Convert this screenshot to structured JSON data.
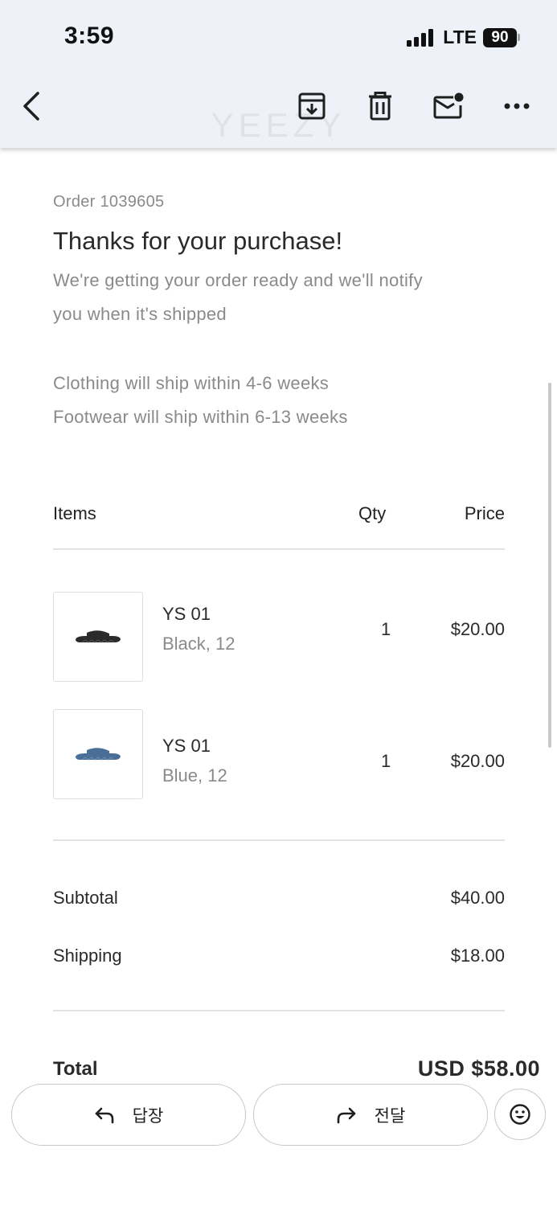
{
  "status_bar": {
    "time": "3:59",
    "network": "LTE",
    "battery": "90"
  },
  "toolbar": {
    "back_icon": "back-icon",
    "archive_icon": "archive-icon",
    "delete_icon": "trash-icon",
    "mark_unread_icon": "mail-unread-icon",
    "more_icon": "more-icon",
    "brand_watermark": "YEEZY"
  },
  "email": {
    "order_number": "Order 1039605",
    "headline": "Thanks for your purchase!",
    "intro_line1": "We're getting your order ready and we'll notify",
    "intro_line2": "you when it's shipped",
    "shipping_note1": "Clothing will ship within 4-6 weeks",
    "shipping_note2": "Footwear will ship within 6-13 weeks",
    "table_headers": {
      "items": "Items",
      "qty": "Qty",
      "price": "Price"
    },
    "items": [
      {
        "name": "YS 01",
        "variant": "Black, 12",
        "qty": "1",
        "price": "$20.00",
        "color": "#2b2b2b"
      },
      {
        "name": "YS 01",
        "variant": "Blue, 12",
        "qty": "1",
        "price": "$20.00",
        "color": "#4a6f96"
      }
    ],
    "subtotal_label": "Subtotal",
    "subtotal_value": "$40.00",
    "shipping_label": "Shipping",
    "shipping_value": "$18.00",
    "total_label": "Total",
    "total_value": "USD $58.00"
  },
  "actions": {
    "reply_label": "답장",
    "forward_label": "전달",
    "reply_icon": "reply-icon",
    "forward_icon": "forward-icon",
    "emoji_icon": "emoji-icon"
  }
}
